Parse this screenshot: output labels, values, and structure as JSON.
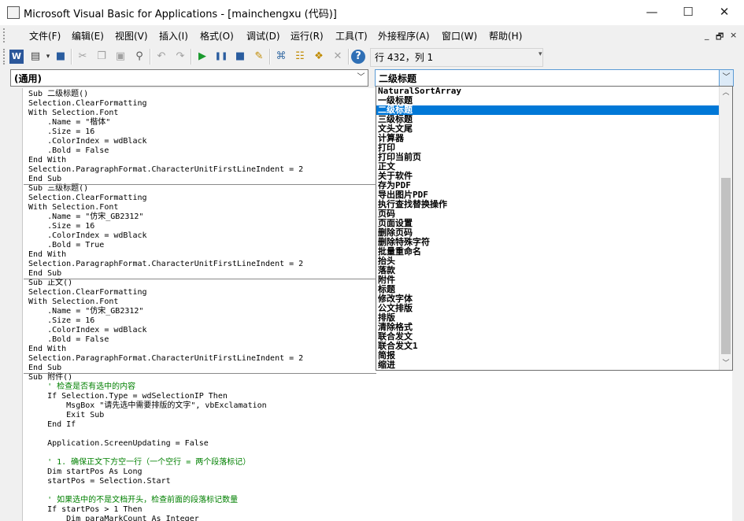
{
  "window": {
    "title": "Microsoft Visual Basic for Applications - [mainchengxu (代码)]",
    "controls": {
      "minimize": "—",
      "maximize": "☐",
      "close": "✕"
    }
  },
  "menubar": {
    "items": [
      "文件(F)",
      "编辑(E)",
      "视图(V)",
      "插入(I)",
      "格式(O)",
      "调试(D)",
      "运行(R)",
      "工具(T)",
      "外接程序(A)",
      "窗口(W)",
      "帮助(H)"
    ],
    "mdi_controls": [
      "_",
      "🗗",
      "×"
    ]
  },
  "toolbar": {
    "position_text": "行 432，列 1",
    "icons": [
      "word-icon",
      "insert-module-icon",
      "save-icon",
      "cut-icon",
      "copy-icon",
      "paste-icon",
      "find-icon",
      "undo-icon",
      "redo-icon",
      "run-icon",
      "break-icon",
      "reset-icon",
      "design-mode-icon",
      "project-explorer-icon",
      "properties-icon",
      "object-browser-icon",
      "toolbox-icon",
      "help-icon"
    ]
  },
  "object_combo": {
    "value": "(通用)"
  },
  "procedure_combo": {
    "value": "二级标题"
  },
  "code": {
    "procedures": [
      [
        "Sub 二级标题()",
        "Selection.ClearFormatting",
        "With Selection.Font",
        "    .Name = \"楷体\"",
        "    .Size = 16",
        "    .ColorIndex = wdBlack",
        "    .Bold = False",
        "End With",
        "Selection.ParagraphFormat.CharacterUnitFirstLineIndent = 2",
        "End Sub"
      ],
      [
        "Sub 三级标题()",
        "Selection.ClearFormatting",
        "With Selection.Font",
        "    .Name = \"仿宋_GB2312\"",
        "    .Size = 16",
        "    .ColorIndex = wdBlack",
        "    .Bold = True",
        "End With",
        "Selection.ParagraphFormat.CharacterUnitFirstLineIndent = 2",
        "End Sub"
      ],
      [
        "Sub 正文()",
        "Selection.ClearFormatting",
        "With Selection.Font",
        "    .Name = \"仿宋_GB2312\"",
        "    .Size = 16",
        "    .ColorIndex = wdBlack",
        "    .Bold = False",
        "End With",
        "Selection.ParagraphFormat.CharacterUnitFirstLineIndent = 2",
        "End Sub"
      ],
      [
        "Sub 附件()",
        "    ' 检查是否有选中的内容",
        "    If Selection.Type = wdSelectionIP Then",
        "        MsgBox \"请先选中需要排版的文字\", vbExclamation",
        "        Exit Sub",
        "    End If",
        "",
        "    Application.ScreenUpdating = False",
        "",
        "    ' 1. 确保正文下方空一行（一个空行 = 两个段落标记）",
        "    Dim startPos As Long",
        "    startPos = Selection.Start",
        "",
        "    ' 如果选中的不是文档开头，检查前面的段落标记数量",
        "    If startPos > 1 Then",
        "        Dim paraMarkCount As Integer"
      ]
    ]
  },
  "dropdown": {
    "items": [
      "NaturalSortArray",
      "一级标题",
      "二级标题",
      "三级标题",
      "文头文尾",
      "计算器",
      "打印",
      "打印当前页",
      "正文",
      "关于软件",
      "存为PDF",
      "导出图片PDF",
      "执行查找替换操作",
      "页码",
      "页面设置",
      "删除页码",
      "删除特殊字符",
      "批量重命名",
      "抬头",
      "落款",
      "附件",
      "标题",
      "修改字体",
      "公文排版",
      "排版",
      "清除格式",
      "联合发文",
      "联合发文1",
      "简报",
      "缩进"
    ],
    "selected_index": 2
  },
  "colors": {
    "selection": "#0078d7",
    "comment": "#008000",
    "chrome": "#f0f0f0"
  }
}
